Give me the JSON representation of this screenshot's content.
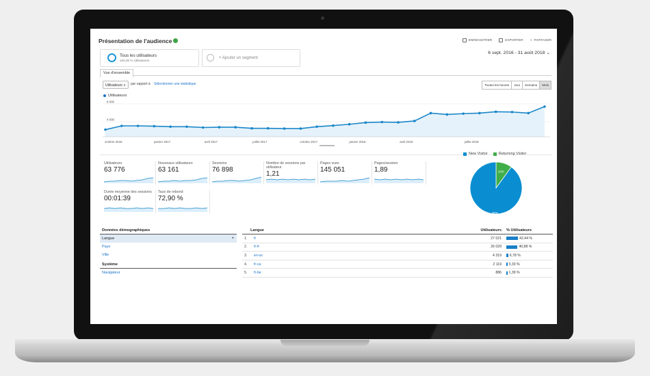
{
  "header": {
    "title": "Présentation de l'audience",
    "actions": [
      "ENREGISTRER",
      "EXPORTER",
      "PARTAGER"
    ]
  },
  "segments": {
    "active_title": "Tous les utilisateurs",
    "active_sub": "100,00 % Utilisateurs",
    "add_label": "+ Ajouter un segment"
  },
  "date_range": "6 sept. 2016 - 31 août 2018",
  "tab": "Vue d'ensemble",
  "controls": {
    "metric": "Utilisateurs",
    "vs_text": "par rapport à",
    "vs_link": "Sélectionner une statistique",
    "granularity": [
      "Toutes les heures",
      "Jour",
      "Semaine",
      "Mois"
    ],
    "active_granularity": "Mois"
  },
  "chart_data": {
    "type": "area",
    "title": "",
    "series": [
      {
        "name": "Utilisateurs",
        "values": [
          1300,
          2000,
          2000,
          1950,
          1850,
          1850,
          1700,
          1750,
          1750,
          1550,
          1550,
          1500,
          1500,
          1850,
          2050,
          2300,
          2600,
          2700,
          2650,
          2900,
          4350,
          4100,
          4250,
          4350,
          4600,
          4550,
          4350,
          5550
        ]
      }
    ],
    "ylim": [
      0,
      6800
    ],
    "y_ticks": [
      "8 000",
      "4 000"
    ],
    "x_labels": [
      "octobre 2016",
      "janvier 2017",
      "avril 2017",
      "juillet 2017",
      "octobre 2017",
      "janvier 2018",
      "avril 2018",
      "juillet 2018"
    ],
    "color": "#1a86c8"
  },
  "metrics": [
    {
      "label": "Utilisateurs",
      "value": "63 776"
    },
    {
      "label": "Nouveaux utilisateurs",
      "value": "63 161"
    },
    {
      "label": "Sessions",
      "value": "76 898"
    },
    {
      "label": "Nombre de sessions par utilisateur",
      "value": "1,21"
    },
    {
      "label": "Pages vues",
      "value": "145 051"
    },
    {
      "label": "Pages/session",
      "value": "1,89"
    },
    {
      "label": "Durée moyenne des sessions",
      "value": "00:01:39"
    },
    {
      "label": "Taux de rebond",
      "value": "72,90 %"
    }
  ],
  "pie": {
    "legend": [
      {
        "name": "New Visitor",
        "color": "#0a8ed1"
      },
      {
        "name": "Returning Visitor",
        "color": "#3fae49"
      }
    ],
    "slices": [
      {
        "name": "New Visitor",
        "value": 90,
        "label": "90%"
      },
      {
        "name": "Returning Visitor",
        "value": 10,
        "label": "10%"
      }
    ]
  },
  "demographics": {
    "title": "Données démographiques",
    "items": [
      "Langue",
      "Pays",
      "Ville"
    ],
    "system_title": "Système",
    "system_items": [
      "Navigateur"
    ]
  },
  "language_table": {
    "headers": {
      "lang": "Langue",
      "users": "Utilisateurs",
      "pct": "% Utilisateurs"
    },
    "rows": [
      {
        "n": "1.",
        "lang": "fr",
        "users": "27 021",
        "pct": "42,44 %",
        "share": 0.4244
      },
      {
        "n": "2.",
        "lang": "fr-fr",
        "users": "26 029",
        "pct": "40,88 %",
        "share": 0.4088
      },
      {
        "n": "3.",
        "lang": "en-us",
        "users": "4 319",
        "pct": "6,78 %",
        "share": 0.0678
      },
      {
        "n": "4.",
        "lang": "fr-ca",
        "users": "2 119",
        "pct": "3,33 %",
        "share": 0.0333
      },
      {
        "n": "5.",
        "lang": "fr-be",
        "users": "886",
        "pct": "1,39 %",
        "share": 0.0139
      }
    ]
  }
}
